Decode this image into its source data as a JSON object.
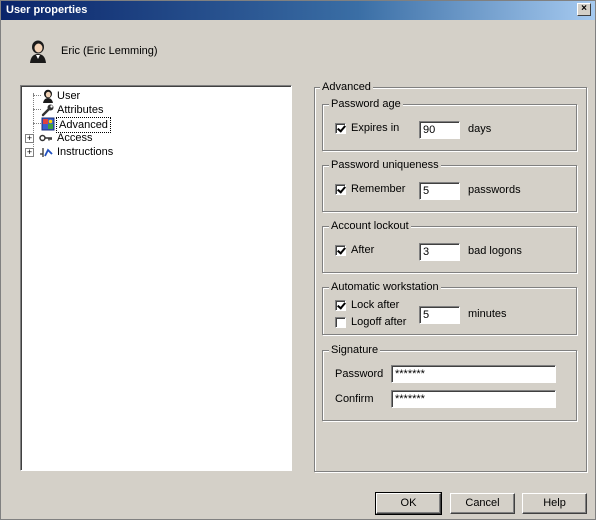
{
  "window": {
    "title": "User properties",
    "close_glyph": "×"
  },
  "user": {
    "display_name": "Eric (Eric Lemming)",
    "icon": "user-avatar-icon"
  },
  "tree": {
    "items": [
      {
        "label": "User",
        "icon": "user-icon"
      },
      {
        "label": "Attributes",
        "icon": "wrench-icon"
      },
      {
        "label": "Advanced",
        "icon": "advanced-icon",
        "selected": true
      },
      {
        "label": "Access",
        "icon": "key-icon",
        "expander": "+"
      },
      {
        "label": "Instructions",
        "icon": "instructions-icon",
        "expander": "+"
      }
    ]
  },
  "advanced": {
    "title": "Advanced",
    "password_age": {
      "title": "Password age",
      "checkbox_label": "Expires in",
      "checked": true,
      "value": "90",
      "unit": "days"
    },
    "password_uniqueness": {
      "title": "Password uniqueness",
      "checkbox_label": "Remember",
      "checked": true,
      "value": "5",
      "unit": "passwords"
    },
    "account_lockout": {
      "title": "Account lockout",
      "checkbox_label": "After",
      "checked": true,
      "value": "3",
      "unit": "bad logons"
    },
    "automatic_workstation": {
      "title": "Automatic workstation",
      "lock_label": "Lock after",
      "lock_checked": true,
      "logoff_label": "Logoff after",
      "logoff_checked": false,
      "value": "5",
      "unit": "minutes"
    },
    "signature": {
      "title": "Signature",
      "password_label": "Password",
      "password_value": "*******",
      "confirm_label": "Confirm",
      "confirm_value": "*******"
    }
  },
  "buttons": {
    "ok": "OK",
    "cancel": "Cancel",
    "help": "Help"
  }
}
